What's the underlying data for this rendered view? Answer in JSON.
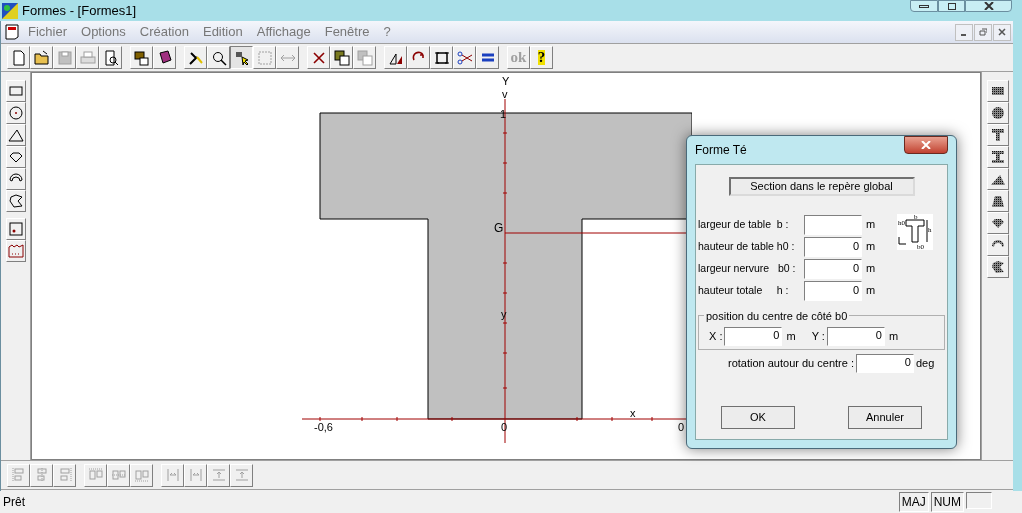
{
  "window": {
    "title": "Formes - [Formes1]"
  },
  "menu": [
    "Fichier",
    "Options",
    "Création",
    "Edition",
    "Affichage",
    "Fenêtre",
    "?"
  ],
  "toolbar": [
    [
      {
        "kind": "new-document",
        "disabled": false,
        "pressed": false
      },
      {
        "kind": "folder",
        "disabled": false,
        "pressed": false
      },
      {
        "kind": "floppy-disk",
        "disabled": true,
        "pressed": false
      },
      {
        "kind": "printer",
        "disabled": true,
        "pressed": false
      },
      {
        "kind": "print-preview",
        "disabled": false,
        "pressed": false
      }
    ],
    [
      {
        "kind": "export",
        "disabled": false,
        "pressed": false
      },
      {
        "kind": "book",
        "disabled": false,
        "pressed": false
      }
    ],
    [
      {
        "kind": "hammer",
        "disabled": false,
        "pressed": false
      },
      {
        "kind": "magnifier",
        "disabled": false,
        "pressed": false
      },
      {
        "kind": "pointer",
        "disabled": false,
        "pressed": true
      },
      {
        "kind": "selection",
        "disabled": true,
        "pressed": false
      },
      {
        "kind": "stretch",
        "disabled": true,
        "pressed": false
      }
    ],
    [
      {
        "kind": "cross",
        "disabled": false,
        "pressed": false
      },
      {
        "kind": "overlap",
        "disabled": false,
        "pressed": false
      },
      {
        "kind": "overlap",
        "disabled": true,
        "pressed": false
      }
    ],
    [
      {
        "kind": "mirror",
        "disabled": false,
        "pressed": false
      },
      {
        "kind": "rotate",
        "disabled": false,
        "pressed": false
      },
      {
        "kind": "frame",
        "disabled": false,
        "pressed": false
      },
      {
        "kind": "scissors",
        "disabled": false,
        "pressed": false
      },
      {
        "kind": "equals",
        "disabled": false,
        "pressed": false
      }
    ],
    [
      {
        "kind": "text",
        "label": "ok",
        "disabled": true,
        "pressed": false
      },
      {
        "kind": "text",
        "label": "?",
        "disabled": false,
        "pressed": false
      }
    ]
  ],
  "left_tools": [
    [
      {
        "kind": "rectangle"
      },
      {
        "kind": "circle"
      },
      {
        "kind": "triangle"
      },
      {
        "kind": "diamond"
      },
      {
        "kind": "arc"
      },
      {
        "kind": "polygon"
      }
    ],
    [
      {
        "kind": "point"
      },
      {
        "kind": "multi-point"
      }
    ]
  ],
  "right_tools": [
    {
      "kind": "rectangle"
    },
    {
      "kind": "circle"
    },
    {
      "kind": "t-beam"
    },
    {
      "kind": "i-beam"
    },
    {
      "kind": "triangle"
    },
    {
      "kind": "trapezoid"
    },
    {
      "kind": "diamond"
    },
    {
      "kind": "arc"
    },
    {
      "kind": "polygon"
    }
  ],
  "canvas": {
    "labels": [
      {
        "kind": "axis",
        "text": "Y"
      },
      {
        "kind": "axis",
        "text": "v"
      },
      {
        "kind": "tick",
        "text": "1"
      },
      {
        "kind": "point",
        "text": "G"
      },
      {
        "kind": "axis",
        "text": "y"
      },
      {
        "kind": "axis",
        "text": "x"
      },
      {
        "kind": "tick",
        "text": "-0,6"
      },
      {
        "kind": "tick",
        "text": "0"
      },
      {
        "kind": "tick",
        "text": "0"
      }
    ]
  },
  "dialog": {
    "title": "Forme Té",
    "header": "Section dans le repère global",
    "fields": [
      {
        "label": "largeur de table  b :",
        "unit": "m"
      },
      {
        "label": "hauteur de table h0 :",
        "value": "0",
        "unit": "m"
      },
      {
        "label": "largeur nervure   b0 :",
        "value": "0",
        "unit": "m"
      },
      {
        "label": "hauteur totale     h :",
        "value": "0",
        "unit": "m"
      }
    ],
    "diagram_labels": [
      "b",
      "h0",
      "h",
      "b0"
    ],
    "position": {
      "legend": "position du centre de côté b0",
      "fields": [
        {
          "label": "X :",
          "value": "0",
          "unit": "m"
        },
        {
          "label": "Y :",
          "value": "0",
          "unit": "m"
        }
      ]
    },
    "rotation": {
      "label": "rotation autour du centre :",
      "value": "0",
      "unit": "deg"
    },
    "buttons": [
      "OK",
      "Annuler"
    ]
  },
  "bottom_tools": [
    [
      {
        "kind": "align-left",
        "disabled": true
      },
      {
        "kind": "align-center",
        "disabled": true
      },
      {
        "kind": "align-right",
        "disabled": true
      }
    ],
    [
      {
        "kind": "align-top",
        "disabled": true
      },
      {
        "kind": "align-middle",
        "disabled": true
      },
      {
        "kind": "align-bottom",
        "disabled": true
      }
    ],
    [
      {
        "kind": "space-horizontal",
        "disabled": true
      },
      {
        "kind": "space-horizontal",
        "disabled": true
      },
      {
        "kind": "space-vertical",
        "disabled": true
      },
      {
        "kind": "space-vertical",
        "disabled": true
      }
    ]
  ],
  "status_bar": {
    "message": "Prêt",
    "indicators": [
      "MAJ",
      "NUM"
    ]
  }
}
